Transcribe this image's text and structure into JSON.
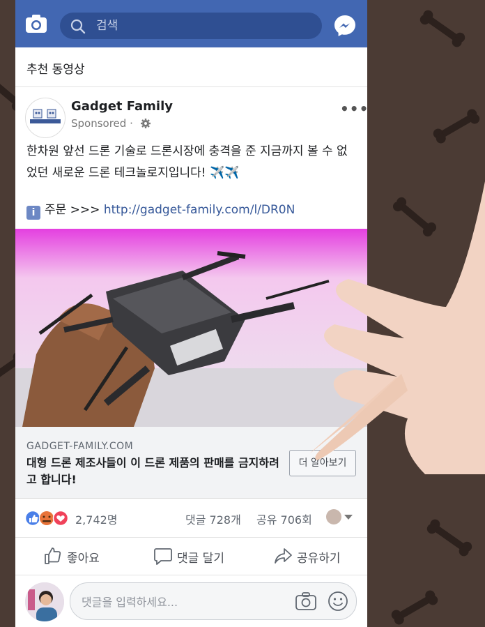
{
  "header": {
    "search_placeholder": "검색"
  },
  "section_title": "추천 동영상",
  "post": {
    "page_name": "Gadget Family",
    "sponsored": "Sponsored ·",
    "text": "한차원 앞선 드론 기술로 드론시장에 충격을 준 지금까지 볼 수 없었던 새로운 드론 테크놀로지입니다! ✈️✈️",
    "order_label": "주문 >>>",
    "link": "http://gadget-family.com/l/DR0N"
  },
  "link_preview": {
    "domain": "GADGET-FAMILY.COM",
    "headline": "대형 드론 제조사들이 이 드론 제품의 판매를 금지하려고 합니다!",
    "cta": "더 알아보기"
  },
  "stats": {
    "reactions": "2,742명",
    "comments": "댓글 728개",
    "shares": "공유 706회"
  },
  "actions": {
    "like": "좋아요",
    "comment": "댓글 달기",
    "share": "공유하기"
  },
  "comment_box": {
    "placeholder": "댓글을 입력하세요..."
  },
  "colors": {
    "brand": "#4267b2",
    "link": "#365899"
  }
}
